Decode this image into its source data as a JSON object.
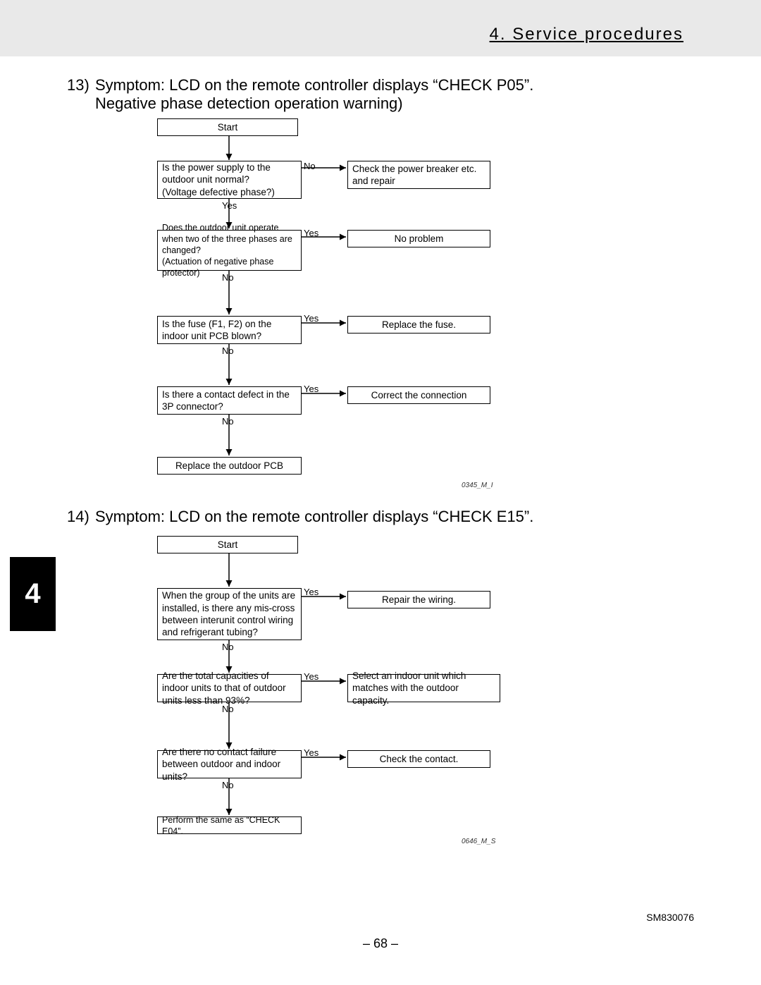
{
  "header": {
    "section_title": "4. Service procedures"
  },
  "chapter_tab": "4",
  "page_number": "– 68 –",
  "doc_id": "SM830076",
  "symptom13": {
    "number": "13)",
    "heading_line1": "Symptom: LCD on the remote controller displays “CHECK P05”.",
    "heading_line2": "Negative phase detection operation warning)",
    "code": "0345_M_I",
    "start": "Start",
    "q1a": "Is the power supply to the outdoor unit normal?",
    "q1b": "(Voltage defective phase?)",
    "a1": "Check the power breaker etc. and repair",
    "q2a": "Does the outdoor unit operate when two of the three phases are changed?",
    "q2b": "(Actuation of negative phase protector)",
    "a2": "No problem",
    "q3": "Is the fuse (F1, F2) on the indoor unit PCB blown?",
    "a3": "Replace the fuse.",
    "q4": "Is there a contact defect in the 3P connector?",
    "a4": "Correct the connection",
    "end": "Replace the outdoor PCB",
    "yes": "Yes",
    "no": "No"
  },
  "symptom14": {
    "number": "14)",
    "heading_line1": "Symptom: LCD on the remote controller displays “CHECK E15”.",
    "code": "0646_M_S",
    "start": "Start",
    "q1": "When the group of the units are installed, is there any mis-cross between interunit control wiring and refrigerant tubing?",
    "a1": "Repair the wiring.",
    "q2": "Are the total capacities of indoor units to that of outdoor units less than 93%?",
    "a2": "Select an indoor unit which matches with the outdoor capacity.",
    "q3": "Are there no contact failure between outdoor and indoor units?",
    "a3": "Check the contact.",
    "end": "Perform the same as “CHECK E04”.",
    "yes": "Yes",
    "no": "No"
  }
}
